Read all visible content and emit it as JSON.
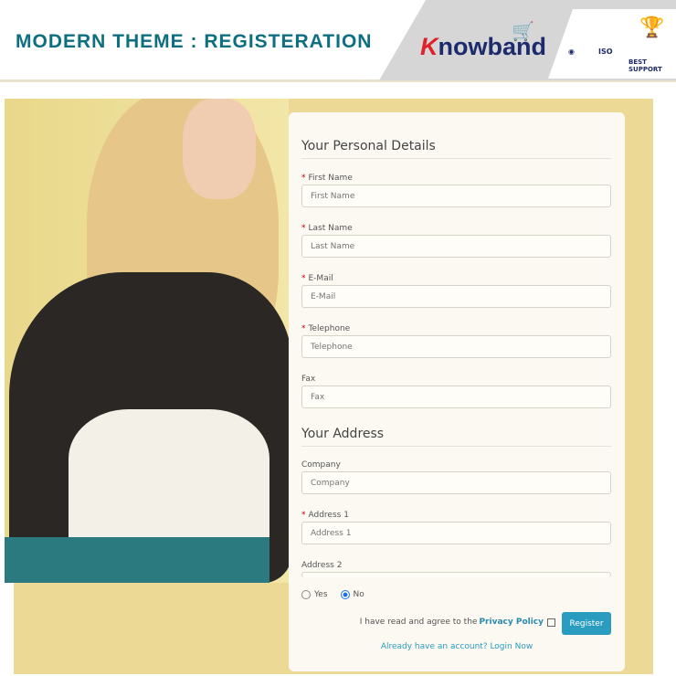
{
  "header": {
    "title": "MODERN THEME : REGISTERATION",
    "logo_text": "Knowband",
    "badges": [
      "ISO",
      "BEST SUPPORT"
    ]
  },
  "form": {
    "personal_title": "Your Personal Details",
    "personal_fields": [
      {
        "label": "First Name",
        "placeholder": "First Name",
        "required": true
      },
      {
        "label": "Last Name",
        "placeholder": "Last Name",
        "required": true
      },
      {
        "label": "E-Mail",
        "placeholder": "E-Mail",
        "required": true
      },
      {
        "label": "Telephone",
        "placeholder": "Telephone",
        "required": true
      },
      {
        "label": "Fax",
        "placeholder": "Fax",
        "required": false
      }
    ],
    "address_title": "Your Address",
    "address_fields": [
      {
        "label": "Company",
        "placeholder": "Company",
        "required": false
      },
      {
        "label": "Address 1",
        "placeholder": "Address 1",
        "required": true
      },
      {
        "label": "Address 2",
        "placeholder": "",
        "required": false
      }
    ],
    "required_mark": "*",
    "radio_yes": "Yes",
    "radio_no": "No",
    "radio_selected": "No",
    "agree_text": "I have read and agree to the",
    "privacy_link": "Privacy Policy",
    "privacy_checked": false,
    "register_label": "Register",
    "login_link": "Already have an account? Login Now"
  },
  "colors": {
    "title": "#0e6f80",
    "button": "#2a9cc0",
    "logo": "#1d2a6b",
    "logo_accent": "#e0202a"
  }
}
